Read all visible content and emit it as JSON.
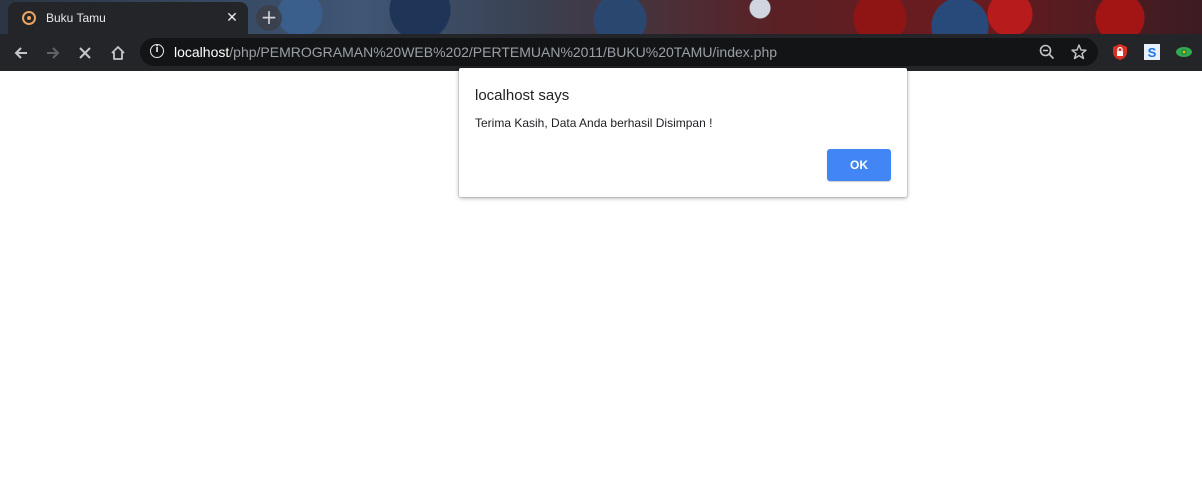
{
  "browser": {
    "tab": {
      "title": "Buku Tamu",
      "close_glyph": "✕",
      "favicon": "loading-spinner-icon"
    },
    "new_tab_glyph": "+",
    "toolbar": {
      "back_icon": "back-arrow-icon",
      "forward_icon": "forward-arrow-icon",
      "stop_icon": "stop-loading-icon",
      "home_icon": "home-icon"
    },
    "omnibox": {
      "info_glyph": "i",
      "url_host": "localhost",
      "url_path": "/php/PEMROGRAMAN%20WEB%202/PERTEMUAN%2011/BUKU%20TAMU/index.php",
      "zoom_icon": "zoom-out-icon",
      "bookmark_icon": "star-icon"
    },
    "extensions": [
      "shield-extension-icon",
      "s-extension-icon",
      "eye-extension-icon"
    ]
  },
  "dialog": {
    "title": "localhost says",
    "message": "Terima Kasih, Data Anda berhasil Disimpan !",
    "ok_label": "OK"
  },
  "colors": {
    "toolbar_bg": "#232529",
    "omnibox_bg": "#131416",
    "ok_button": "#4285f4"
  }
}
